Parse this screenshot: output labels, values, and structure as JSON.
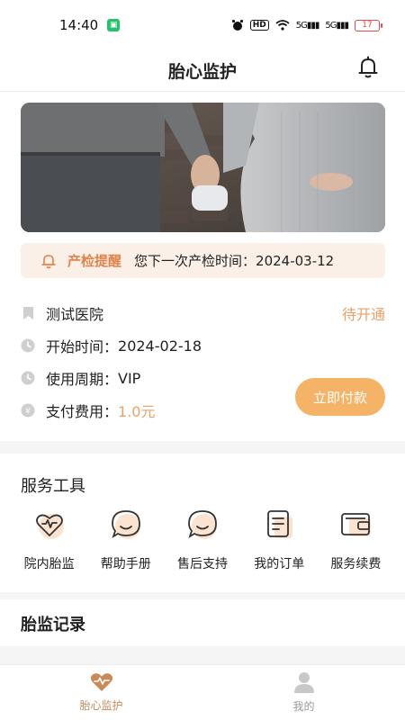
{
  "status_bar": {
    "time": "14:40",
    "hd": "HD",
    "signal_a": "5G",
    "signal_b": "5G",
    "battery": "17"
  },
  "nav": {
    "title": "胎心监护"
  },
  "reminder": {
    "label": "产检提醒",
    "text": "您下一次产检时间：",
    "date": "2024-03-12"
  },
  "hospital": {
    "name": "测试医院",
    "status": "待开通"
  },
  "info": {
    "start_label": "开始时间：",
    "start_value": "2024-02-18",
    "period_label": "使用周期：",
    "period_value": "VIP",
    "fee_label": "支付费用：",
    "fee_value": "1.0元",
    "pay_button": "立即付款"
  },
  "tools": {
    "title": "服务工具",
    "items": [
      {
        "label": "院内胎监",
        "icon": "heart-monitor-icon"
      },
      {
        "label": "帮助手册",
        "icon": "chat-bubble-icon"
      },
      {
        "label": "售后支持",
        "icon": "chat-bubble-icon"
      },
      {
        "label": "我的订单",
        "icon": "document-icon"
      },
      {
        "label": "服务续费",
        "icon": "wallet-icon"
      }
    ]
  },
  "records": {
    "title": "胎监记录"
  },
  "tab_bar": {
    "items": [
      {
        "label": "胎心监护",
        "icon": "heart-monitor-icon",
        "active": true
      },
      {
        "label": "我的",
        "icon": "person-icon",
        "active": false
      }
    ]
  },
  "colors": {
    "accent": "#e8a169",
    "pay_button": "#f5b368",
    "reminder_bg": "#fbf0e8",
    "tab_active": "#c98a5a"
  }
}
